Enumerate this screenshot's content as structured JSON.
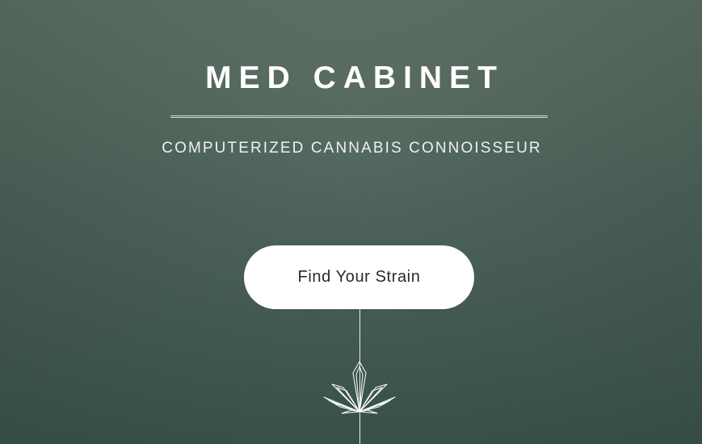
{
  "hero": {
    "title": "MED CABINET",
    "subtitle": "COMPUTERIZED CANNABIS CONNOISSEUR",
    "cta_label": "Find Your Strain"
  },
  "icons": {
    "leaf": "cannabis-leaf-line-icon"
  },
  "colors": {
    "background_top": "#5c7064",
    "background_bottom": "#3b554c",
    "text": "#ffffff",
    "button_bg": "#ffffff",
    "button_text": "#2b2b2b"
  }
}
